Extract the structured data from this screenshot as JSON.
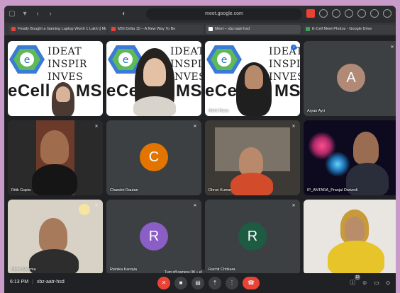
{
  "browser": {
    "url": "meet.google.com",
    "tabs": [
      {
        "label": "Finally Bought a Gaming Laptop Worth 1 Lakh || Mo...",
        "color": "#ea4335"
      },
      {
        "label": "MSI Delta 15 – A New Way To Be",
        "color": "#ea4335"
      },
      {
        "label": "Meet – xbz-aatr-hsd",
        "color": "#34a853"
      },
      {
        "label": "E-Cell Meet Photos - Google Drive",
        "color": "#34a853"
      }
    ]
  },
  "logo": {
    "letter": "e",
    "cell": "eCell",
    "msit": "MSIT",
    "words": [
      "IDEAT",
      "INSPIR",
      "INVES"
    ]
  },
  "participants": [
    {
      "name": "",
      "avatar": ""
    },
    {
      "name": "",
      "avatar": ""
    },
    {
      "name": "Mohit Rana",
      "avatar": ""
    },
    {
      "name": "Aryan Ayri",
      "avatar": "A",
      "color": "#b08a76"
    },
    {
      "name": "Ritik Gupta",
      "avatar": ""
    },
    {
      "name": "Chandni Rautan",
      "avatar": "C",
      "color": "#e37400"
    },
    {
      "name": "Dhruv Kumar",
      "avatar": ""
    },
    {
      "name": "IP_ANTARA_Pranjal Dwivedi",
      "avatar": ""
    },
    {
      "name": "Nishit Sharma",
      "avatar": ""
    },
    {
      "name": "Rishika Kanojia",
      "avatar": "R",
      "color": "#8b5ec6"
    },
    {
      "name": "Rachit Chitkara",
      "avatar": "R",
      "color": "#1e5b43"
    },
    {
      "name": "",
      "avatar": ""
    }
  ],
  "bottom": {
    "time": "6:13 PM",
    "separator": "|",
    "meeting_code": "xbz-aatr-hsd",
    "tooltip": "Turn off camera (⌘ + e)",
    "badge": "12"
  }
}
